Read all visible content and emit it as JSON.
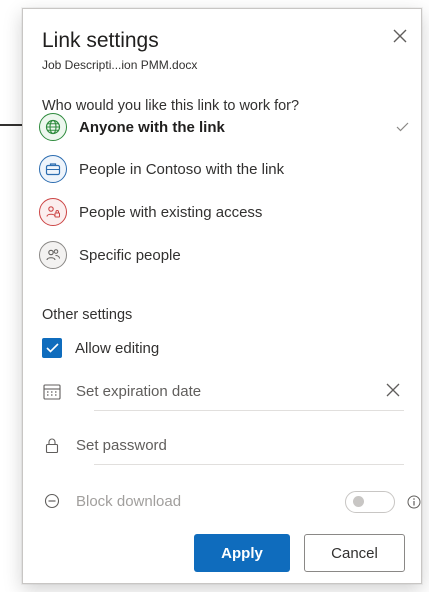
{
  "dialog": {
    "title": "Link settings",
    "file_name": "Job Descripti...ion PMM.docx",
    "close_label": "Close"
  },
  "audience": {
    "heading": "Who would you like this link to work for?",
    "options": [
      {
        "label": "Anyone with the link",
        "selected": true,
        "icon": "globe-icon",
        "color": "#2e8b3d"
      },
      {
        "label": "People in Contoso with the link",
        "selected": false,
        "icon": "briefcase-icon",
        "color": "#2b6cb0"
      },
      {
        "label": "People with existing access",
        "selected": false,
        "icon": "people-lock-icon",
        "color": "#c44444"
      },
      {
        "label": "Specific people",
        "selected": false,
        "icon": "people-icon",
        "color": "#8a8886"
      }
    ]
  },
  "other_settings": {
    "heading": "Other settings",
    "allow_editing": {
      "label": "Allow editing",
      "checked": true
    },
    "expiration": {
      "placeholder": "Set expiration date",
      "icon": "calendar-icon"
    },
    "password": {
      "placeholder": "Set password",
      "icon": "lock-icon"
    },
    "block_download": {
      "label": "Block download",
      "enabled": false,
      "icon": "block-icon"
    }
  },
  "actions": {
    "apply_label": "Apply",
    "cancel_label": "Cancel"
  },
  "colors": {
    "accent": "#0f6cbd",
    "text": "#323130",
    "muted": "#a19f9d"
  }
}
